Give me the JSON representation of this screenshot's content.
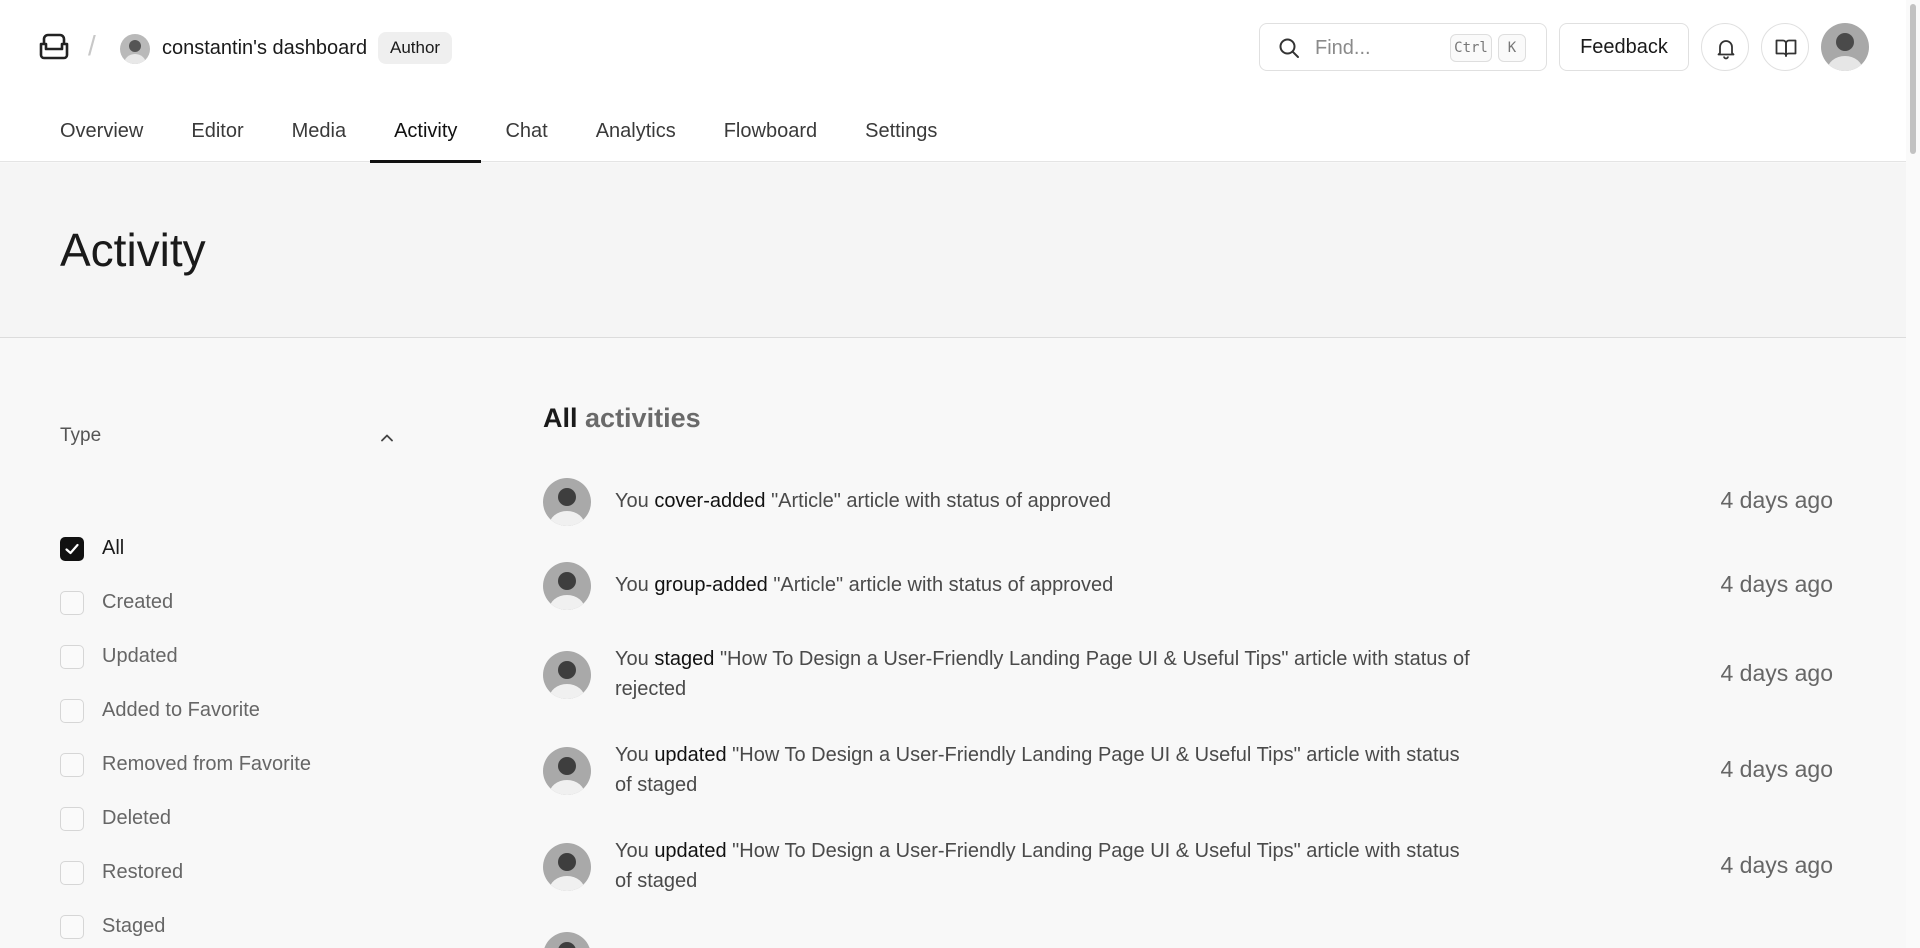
{
  "header": {
    "team_name": "constantin's dashboard",
    "role": "Author",
    "search_placeholder": "Find...",
    "search_shortcut_mod": "Ctrl",
    "search_shortcut_key": "K",
    "feedback_label": "Feedback"
  },
  "tabs": [
    "Overview",
    "Editor",
    "Media",
    "Activity",
    "Chat",
    "Analytics",
    "Flowboard",
    "Settings"
  ],
  "active_tab": "Activity",
  "page": {
    "title": "Activity"
  },
  "filter": {
    "title": "Type",
    "items": [
      {
        "label": "All",
        "checked": true
      },
      {
        "label": "Created",
        "checked": false
      },
      {
        "label": "Updated",
        "checked": false
      },
      {
        "label": "Added to Favorite",
        "checked": false
      },
      {
        "label": "Removed from Favorite",
        "checked": false
      },
      {
        "label": "Deleted",
        "checked": false
      },
      {
        "label": "Restored",
        "checked": false
      },
      {
        "label": "Staged",
        "checked": false
      }
    ]
  },
  "activities_heading": {
    "strong": "All",
    "muted": "activities"
  },
  "activities": [
    {
      "actor": "You",
      "verb": "cover-added",
      "rest": "\"Article\" article with status of approved",
      "time": "4 days ago"
    },
    {
      "actor": "You",
      "verb": "group-added",
      "rest": "\"Article\" article with status of approved",
      "time": "4 days ago"
    },
    {
      "actor": "You",
      "verb": "staged",
      "rest": "\"How To Design a User-Friendly Landing Page UI & Useful Tips\" article with status of rejected",
      "time": "4 days ago"
    },
    {
      "actor": "You",
      "verb": "updated",
      "rest": "\"How To Design a User-Friendly Landing Page UI & Useful Tips\" article with status of staged",
      "time": "4 days ago"
    },
    {
      "actor": "You",
      "verb": "updated",
      "rest": "\"How To Design a User-Friendly Landing Page UI & Useful Tips\" article with status of staged",
      "time": "4 days ago"
    }
  ]
}
